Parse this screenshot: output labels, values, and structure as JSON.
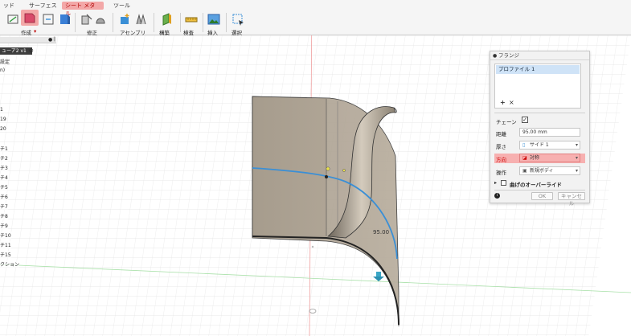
{
  "ribbon": {
    "tabs": [
      "ッド",
      "サーフェス",
      "シート メタル",
      "ツール"
    ],
    "groups": {
      "create": "作成",
      "modify": "修正",
      "assemble": "アセンブリ",
      "construct": "構築",
      "inspect": "検査",
      "insert": "挿入",
      "select": "選択"
    }
  },
  "browser": {
    "title": "ューア2 v1",
    "items": [
      "設定",
      "n)",
      "1",
      "19",
      "20",
      "チ1",
      "チ2",
      "チ3",
      "チ4",
      "チ5",
      "チ6",
      "チ7",
      "チ8",
      "チ9",
      "チ10",
      "チ11",
      "チ15",
      "クション"
    ]
  },
  "viewport": {
    "dimension_label": "95.00"
  },
  "dialog": {
    "title": "フランジ",
    "profile_item": "プロファイル 1",
    "add_symbol": "+",
    "remove_symbol": "×",
    "chain_label": "チェーン",
    "distance_label": "距離",
    "distance_value": "95.00 mm",
    "thickness_label": "厚さ",
    "thickness_value": "サイド 1",
    "direction_label": "方向",
    "direction_value": "対称",
    "operation_label": "操作",
    "operation_value": "新規ボディ",
    "bend_override_label": "曲げのオーバーライド",
    "ok_label": "OK",
    "cancel_label": "キャンセル",
    "info_symbol": "i"
  },
  "colors": {
    "tab_active_bg": "#f3a8a8",
    "sheet_fill": "#a89e8f",
    "curve": "#3a8fd6",
    "highlight": "#f7b0b0"
  }
}
